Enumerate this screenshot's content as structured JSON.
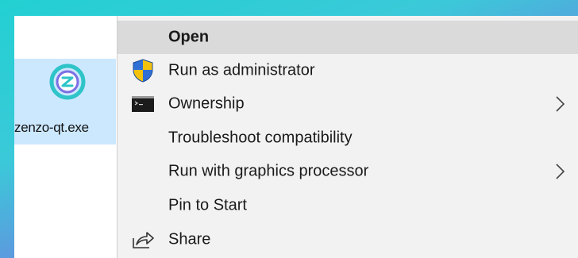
{
  "desktop": {
    "file": {
      "name": "zenzo-qt.exe",
      "icon": "zenzo-app-icon",
      "selected": true
    }
  },
  "context_menu": {
    "items": [
      {
        "label": "Open",
        "bold": true,
        "icon": null,
        "submenu": false,
        "highlighted": true
      },
      {
        "label": "Run as administrator",
        "bold": false,
        "icon": "uac-shield-icon",
        "submenu": false
      },
      {
        "label": "Ownership",
        "bold": false,
        "icon": "command-prompt-icon",
        "submenu": true
      },
      {
        "label": "Troubleshoot compatibility",
        "bold": false,
        "icon": null,
        "submenu": false
      },
      {
        "label": "Run with graphics processor",
        "bold": false,
        "icon": null,
        "submenu": true
      },
      {
        "label": "Pin to Start",
        "bold": false,
        "icon": null,
        "submenu": false
      },
      {
        "label": "Share",
        "bold": false,
        "icon": "share-icon",
        "submenu": false
      }
    ]
  },
  "colors": {
    "frame_start": "#22d0d2",
    "frame_end": "#8a5fe6",
    "menu_background": "#f2f2f2",
    "menu_hover": "#dadada",
    "selection": "#cce8ff",
    "app_icon": "#2ec4c8"
  }
}
